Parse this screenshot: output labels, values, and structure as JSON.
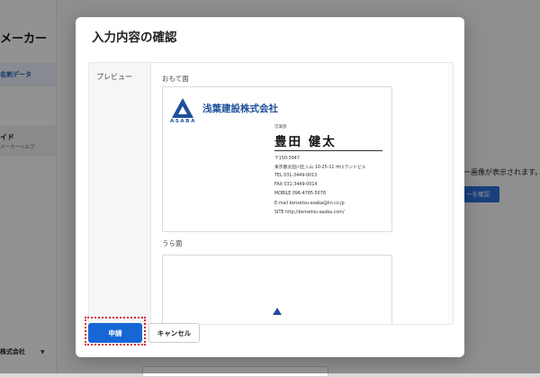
{
  "background": {
    "app_title": "メーカー",
    "nav_active_label": "名刺データ",
    "guide_title": "イド",
    "guide_subtitle": "メーカーヘルプ",
    "company_selector": "株式会社",
    "main_message": "ー画像が表示されます。",
    "main_button_label": "ーを確認"
  },
  "modal": {
    "title": "入力内容の確認",
    "preview_label": "プレビュー",
    "front_label": "おもて面",
    "back_label": "うら面",
    "card": {
      "logo_text": "ASABA",
      "company_name": "浅葉建設株式会社",
      "department": "営業部",
      "person_name": "豊田 健太",
      "postal": "〒150-3947",
      "address": "東京都太田川区入山 10-25-11 中川ランドビル",
      "tel": "TEL 031-3449-0013",
      "fax": "FAX 031-3449-0014",
      "mobile": "MOBILE 096-4785-5678",
      "email": "E-mail kensetsu-asaba@kn.co.jp",
      "site": "SITE http://kensetsu-asaba.com/"
    },
    "apply_label": "申請",
    "cancel_label": "キャンセル"
  },
  "colors": {
    "brand_blue": "#1e4f9c",
    "primary_button": "#1766d6",
    "highlight": "#d81e1e"
  }
}
